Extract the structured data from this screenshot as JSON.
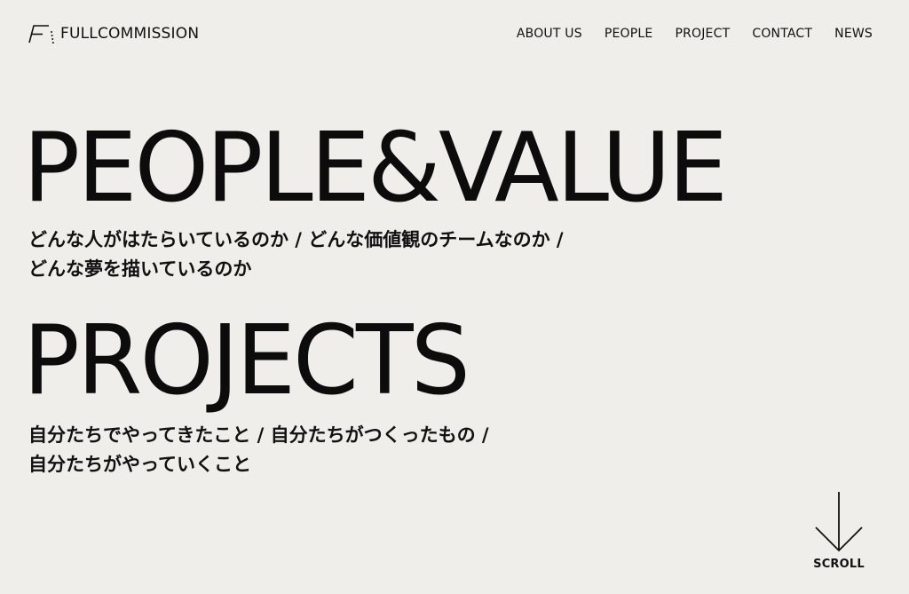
{
  "header": {
    "logo_text": "FULLCOMMISSION",
    "nav": [
      {
        "label": "ABOUT US"
      },
      {
        "label": "PEOPLE"
      },
      {
        "label": "PROJECT"
      },
      {
        "label": "CONTACT"
      },
      {
        "label": "NEWS"
      }
    ]
  },
  "sections": {
    "people_value": {
      "title": "PEOPLE&VALUE",
      "subtitle_lines": [
        "どんな人がはたらいているのか / どんな価値観のチームなのか /",
        "どんな夢を描いているのか"
      ]
    },
    "projects": {
      "title": "PROJECTS",
      "subtitle_lines": [
        "自分たちでやってきたこと / 自分たちがつくったもの /",
        "自分たちがやっていくこと"
      ]
    }
  },
  "scroll": {
    "label": "SCROLL"
  },
  "colors": {
    "background": "#efeeea",
    "text": "#111111"
  }
}
